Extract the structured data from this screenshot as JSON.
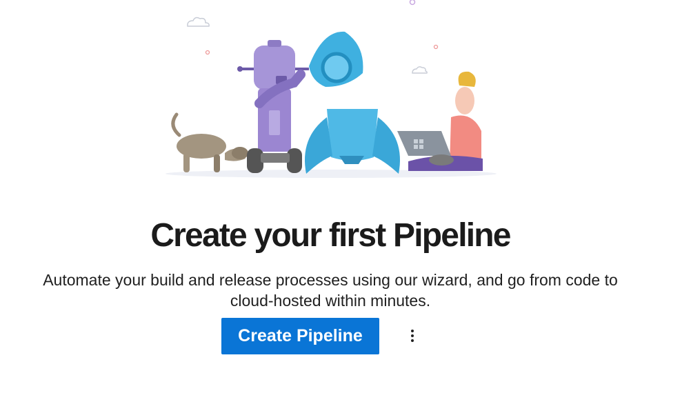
{
  "empty_state": {
    "illustration_icon": "pipeline-robot-rocket-illustration",
    "title": "Create your first Pipeline",
    "description": "Automate your build and release processes using our wizard, and go from code to cloud-hosted within minutes.",
    "primary_button_label": "Create Pipeline",
    "more_actions_icon": "more-vertical-icon"
  },
  "colors": {
    "primary": "#0a75d6",
    "robot": "#9b86d1",
    "rocket": "#3fb0e0",
    "person_shirt": "#f28b82"
  }
}
